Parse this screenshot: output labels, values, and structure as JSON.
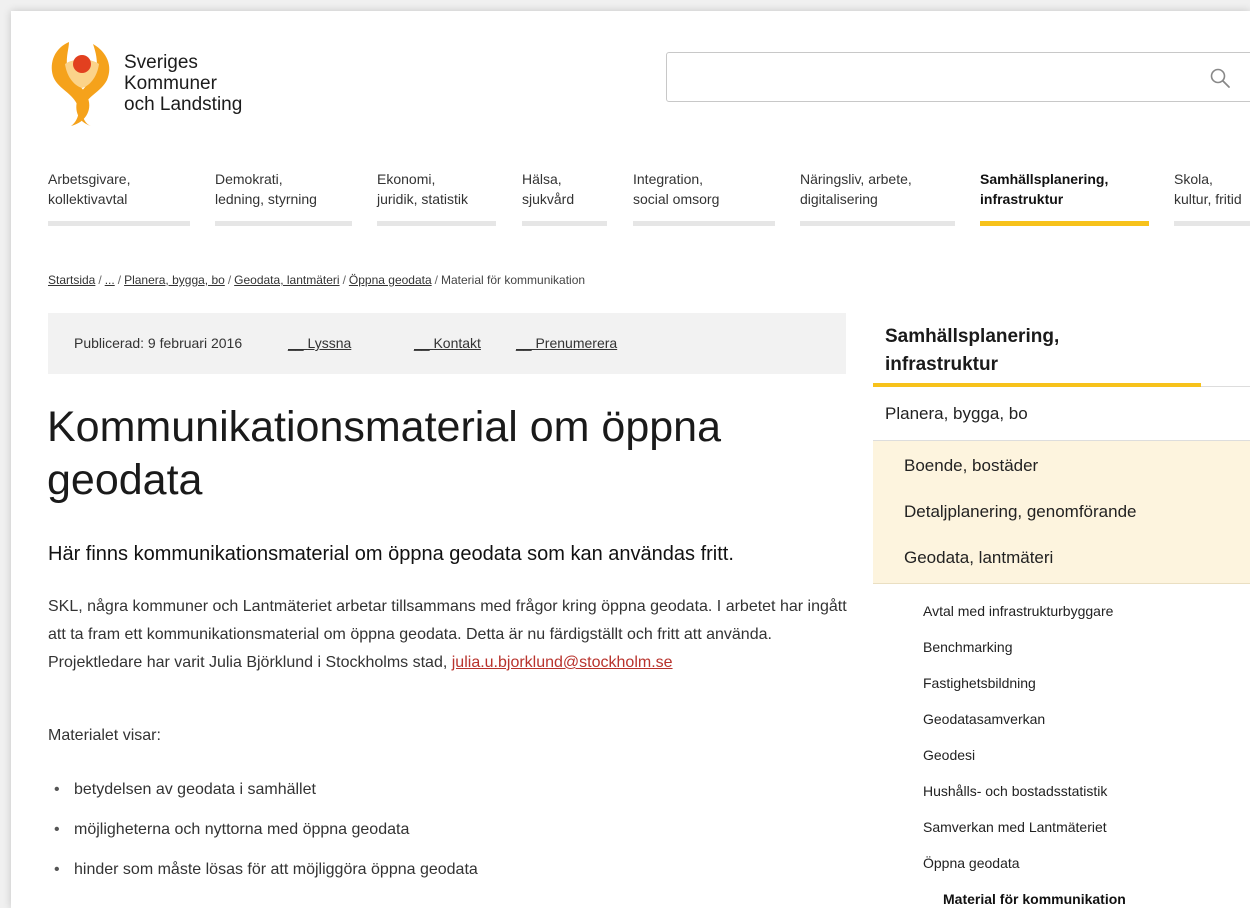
{
  "brand": {
    "name_lines": [
      "Sveriges",
      "Kommuner",
      "och Landsting"
    ],
    "colors": {
      "orange": "#f5a21b",
      "red": "#e2401f",
      "yellow": "#f7c21b"
    }
  },
  "search": {
    "placeholder": "",
    "icon": "search-icon"
  },
  "nav": [
    {
      "line1": "Arbetsgivare,",
      "line2": "kollektivavtal"
    },
    {
      "line1": "Demokrati,",
      "line2": "ledning, styrning"
    },
    {
      "line1": "Ekonomi,",
      "line2": "juridik, statistik"
    },
    {
      "line1": "Hälsa,",
      "line2": "sjukvård"
    },
    {
      "line1": "Integration,",
      "line2": "social omsorg"
    },
    {
      "line1": "Näringsliv, arbete,",
      "line2": "digitalisering"
    },
    {
      "line1": "Samhällsplanering,",
      "line2": "infrastruktur",
      "active": true
    },
    {
      "line1": "Skola,",
      "line2": "kultur, fritid"
    }
  ],
  "breadcrumb": {
    "items": [
      "Startsida",
      "...",
      "Planera, bygga, bo",
      "Geodata, lantmäteri",
      "Öppna geodata"
    ],
    "current": "Material för kommunikation",
    "separator": "/"
  },
  "pubbar": {
    "published": "Publicerad: 9 februari 2016",
    "listen": "Lyssna",
    "contact": "Kontakt",
    "subscribe": "Prenumerera"
  },
  "article": {
    "title": "Kommunikationsmaterial om öppna geodata",
    "lead": "Här finns kommunikationsmaterial om öppna geodata som kan användas fritt.",
    "paragraph": "SKL, några kommuner och Lantmäteriet arbetar tillsammans med frågor kring öppna geodata. I arbetet har ingått att ta fram ett kommunikationsmaterial om öppna geodata. Detta är nu färdigställt och fritt att använda. Projektledare har varit Julia Björklund i Stockholms stad,",
    "email": "julia.u.bjorklund@stockholm.se",
    "intro_list": "Materialet visar:",
    "list": [
      "betydelsen av geodata i samhället",
      "möjligheterna och nyttorna med öppna geodata",
      "hinder som måste lösas för att möjliggöra öppna geodata"
    ]
  },
  "sidebar": {
    "heading_line1": "Samhällsplanering,",
    "heading_line2": "infrastruktur",
    "level1": "Planera, bygga, bo",
    "level2": [
      "Boende, bostäder",
      "Detaljplanering, genomförande",
      "Geodata, lantmäteri"
    ],
    "level3": [
      "Avtal med infrastrukturbyggare",
      "Benchmarking",
      "Fastighetsbildning",
      "Geodatasamverkan",
      "Geodesi",
      "Hushålls- och bostadsstatistik",
      "Samverkan med Lantmäteriet",
      "Öppna geodata"
    ],
    "level4": "Material för kommunikation"
  }
}
